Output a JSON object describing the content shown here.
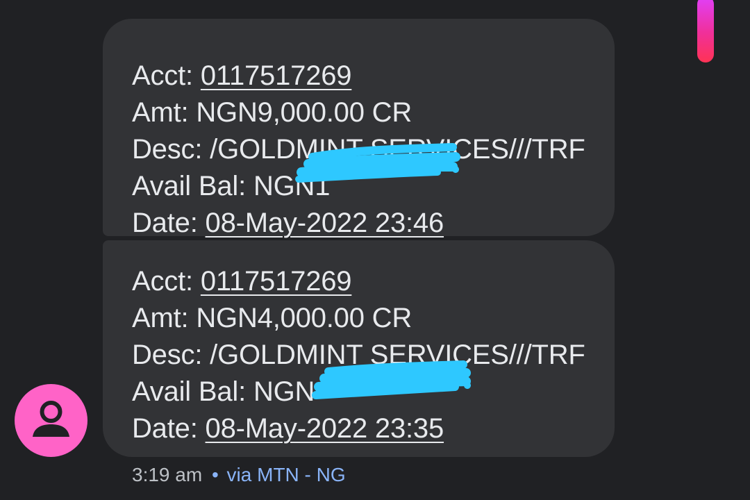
{
  "messages": [
    {
      "acct_label": "Acct:",
      "acct_value": "0117517269",
      "amt_label": "Amt:",
      "amt_value": "NGN9,000.00 CR",
      "desc_label": "Desc:",
      "desc_value": "/GOLDMINT SERVICES///TRF",
      "bal_label": "Avail Bal:",
      "bal_value": "NGN1",
      "bal_redacted": true,
      "date_label": "Date:",
      "date_value": "08-May-2022 23:46"
    },
    {
      "acct_label": "Acct:",
      "acct_value": "0117517269",
      "amt_label": "Amt:",
      "amt_value": "NGN4,000.00 CR",
      "desc_label": "Desc:",
      "desc_value": "/GOLDMINT SERVICES///TRF",
      "bal_label": "Avail Bal:",
      "bal_value": "NGN",
      "bal_redacted": true,
      "date_label": "Date:",
      "date_value": "08-May-2022 23:35"
    }
  ],
  "footer": {
    "time": "3:19 am",
    "separator": "•",
    "via": "via MTN - NG"
  },
  "colors": {
    "background": "#202124",
    "bubble": "#323336",
    "text": "#e8eaed",
    "avatar": "#ff63c7",
    "redaction": "#2ec8ff",
    "via_link": "#8ab4f8"
  },
  "icons": {
    "avatar": "person-icon"
  }
}
